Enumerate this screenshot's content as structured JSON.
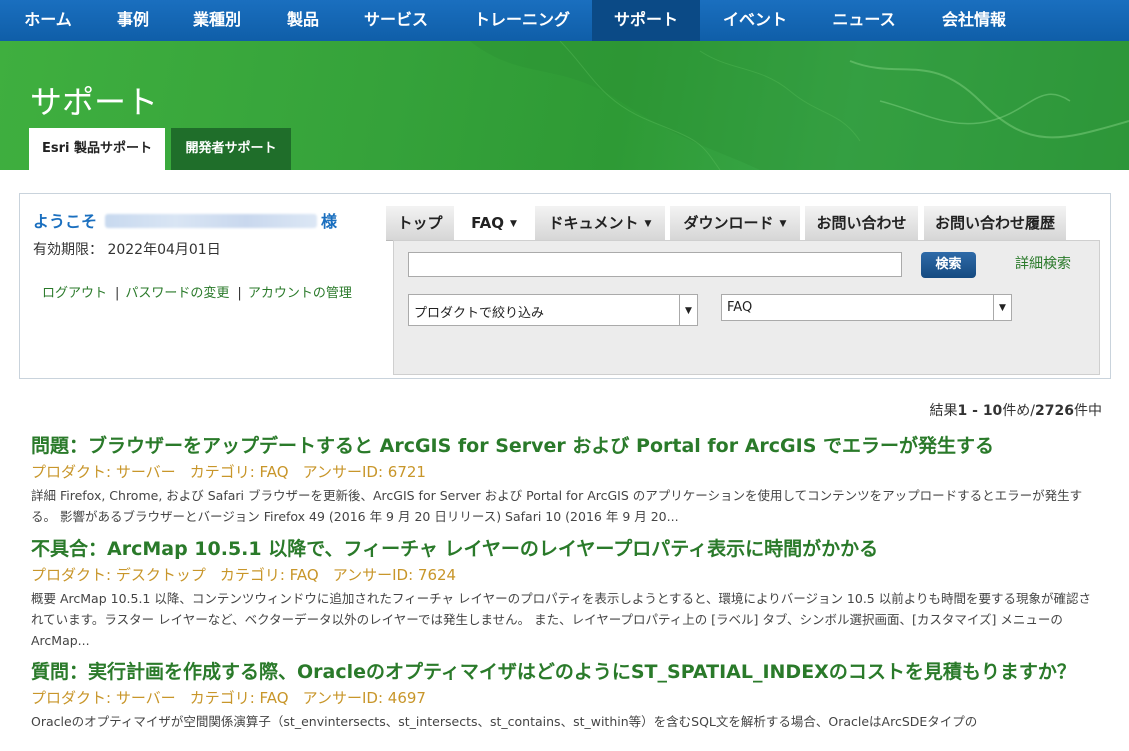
{
  "nav": {
    "items": [
      "ホーム",
      "事例",
      "業種別",
      "製品",
      "サービス",
      "トレーニング",
      "サポート",
      "イベント",
      "ニュース",
      "会社情報"
    ],
    "active": "サポート"
  },
  "banner": {
    "title": "サポート",
    "tabs": [
      "Esri 製品サポート",
      "開発者サポート"
    ]
  },
  "account": {
    "welcome_prefix": "ようこそ",
    "welcome_suffix": "様",
    "expiry_label": "有効期限：",
    "expiry_date": "2022年04月01日",
    "links": [
      "ログアウト",
      "パスワードの変更",
      "アカウントの管理"
    ],
    "separator": "|"
  },
  "search": {
    "tabs": [
      "トップ",
      "FAQ",
      "ドキュメント",
      "ダウンロード",
      "お問い合わせ",
      "お問い合わせ履歴"
    ],
    "selected_tab": "FAQ",
    "query_value": "",
    "button_label": "検索",
    "advanced_label": "詳細検索",
    "product_filter": "プロダクトで絞り込み",
    "type_filter": "FAQ"
  },
  "results_count": {
    "prefix": "結果",
    "range": "1 - 10",
    "mid": "件め/",
    "total": "2726",
    "suffix": "件中"
  },
  "results": [
    {
      "title": "問題：ブラウザーをアップデートすると ArcGIS for Server および Portal for ArcGIS でエラーが発生する",
      "product": "プロダクト: サーバー",
      "category": "カテゴリ: FAQ",
      "answer_id": "アンサーID: 6721",
      "description": "詳細 Firefox, Chrome, および Safari ブラウザーを更新後、ArcGIS for Server および Portal for ArcGIS のアプリケーションを使用してコンテンツをアップロードするとエラーが発生する。 影響があるブラウザーとバージョン Firefox 49 (2016 年 9 月 20 日リリース) Safari 10 (2016 年 9 月 20..."
    },
    {
      "title": "不具合：ArcMap 10.5.1 以降で、フィーチャ レイヤーのレイヤープロパティ表示に時間がかかる",
      "product": "プロダクト: デスクトップ",
      "category": "カテゴリ: FAQ",
      "answer_id": "アンサーID: 7624",
      "description": "概要 ArcMap 10.5.1 以降、コンテンツウィンドウに追加されたフィーチャ レイヤーのプロパティを表示しようとすると、環境によりバージョン 10.5 以前よりも時間を要する現象が確認されています。ラスター レイヤーなど、ベクターデータ以外のレイヤーでは発生しません。 また、レイヤープロパティ上の [ラベル] タブ、シンボル選択画面、[カスタマイズ] メニューの ArcMap..."
    },
    {
      "title": "質問：実行計画を作成する際、OracleのオプティマイザはどのようにST_SPATIAL_INDEXのコストを見積もりますか？",
      "product": "プロダクト: サーバー",
      "category": "カテゴリ: FAQ",
      "answer_id": "アンサーID: 4697",
      "description": "Oracleのオプティマイザが空間関係演算子（st_envintersects、st_intersects、st_contains、st_within等）を含むSQL文を解析する場合、OracleはArcSDEタイプの"
    }
  ],
  "colors": {
    "nav_bg": "#1a6fbf",
    "nav_active": "#0b4a86",
    "banner_green": "#35a23a",
    "link_green": "#2a7a2a",
    "meta_gold": "#c8962a",
    "welcome_blue": "#1a6fbf"
  }
}
